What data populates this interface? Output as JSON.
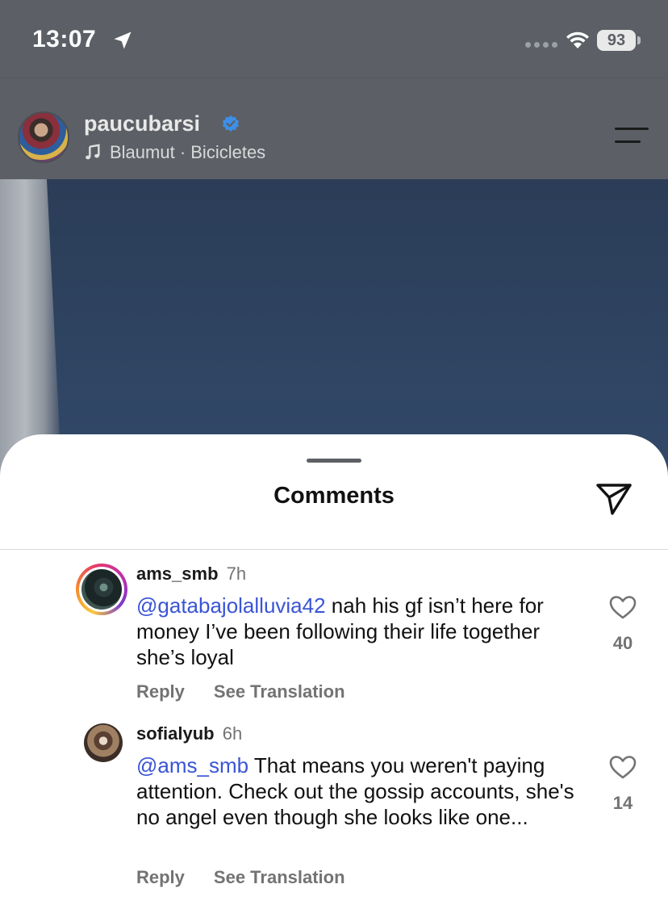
{
  "status_bar": {
    "time": "13:07",
    "battery": "93"
  },
  "post": {
    "username": "paucubarsi",
    "music": "Blaumut · Bicicletes"
  },
  "comments_sheet": {
    "title": "Comments",
    "comments": [
      {
        "user": "ams_smb",
        "age": "7h",
        "mention": "@gatabajolalluvia42",
        "text": " nah his gf isn’t here for money I’ve been following their life together she’s loyal",
        "reply_label": "Reply",
        "translate_label": "See Translation",
        "likes": "40"
      },
      {
        "user": "sofialyub",
        "age": "6h",
        "mention": "@ams_smb",
        "text": " That means you weren't paying attention. Check out the gossip accounts, she's no angel even though she looks like one...",
        "reply_label": "Reply",
        "translate_label": "See Translation",
        "likes": "14"
      }
    ]
  },
  "colors": {
    "mention": "#3a54d6",
    "secondary_text": "#737373",
    "dim_overlay": "#5c6066"
  }
}
